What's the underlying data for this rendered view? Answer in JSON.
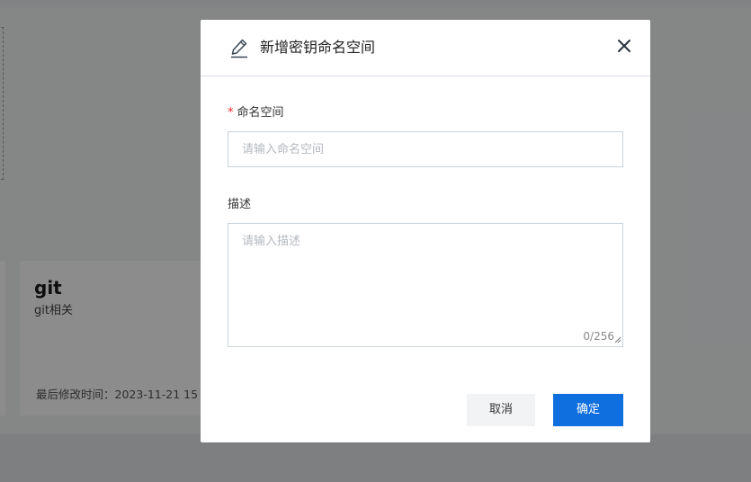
{
  "background": {
    "card": {
      "title": "git",
      "description": "git相关",
      "meta": "最后修改时间：2023-11-21 15"
    }
  },
  "modal": {
    "title": "新增密钥命名空间",
    "header_icon": "edit-pencil-icon",
    "close_icon": "close-icon",
    "namespace": {
      "required_mark": "*",
      "label": "命名空间",
      "placeholder": "请输入命名空间",
      "value": ""
    },
    "description": {
      "label": "描述",
      "placeholder": "请输入描述",
      "value": "",
      "counter": "0/256"
    },
    "buttons": {
      "cancel": "取消",
      "ok": "确定"
    }
  },
  "colors": {
    "primary": "#0f6fde",
    "required": "#f5222d",
    "mask": "rgba(0,0,0,0.45)"
  }
}
